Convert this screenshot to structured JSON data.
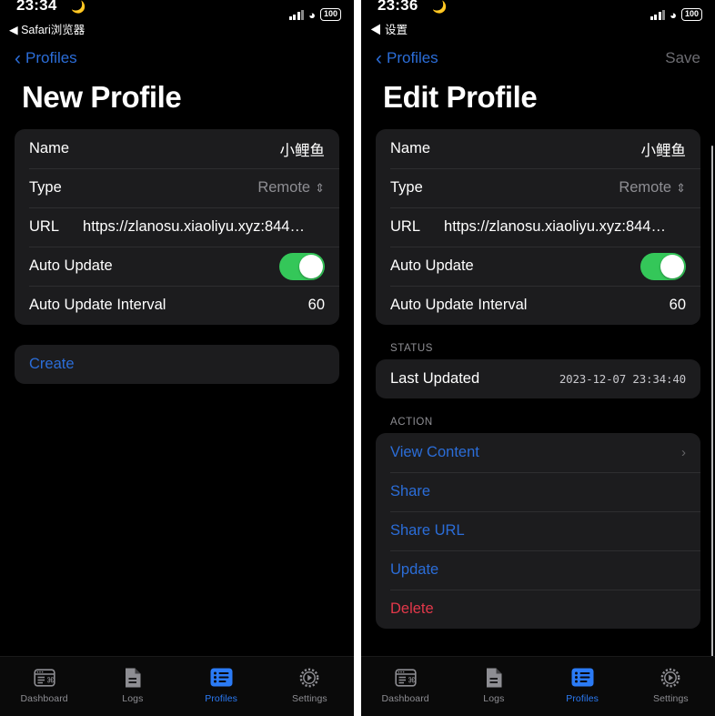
{
  "left": {
    "statusbar": {
      "time": "23:34",
      "moon_icon": "moon-icon",
      "back_app": "◀ Safari浏览器",
      "signal_icon": "cellular-bars-icon",
      "wifi_icon": "wifi-icon",
      "battery": "100"
    },
    "nav": {
      "back_label": "Profiles",
      "back_icon": "chevron-left-icon",
      "action_label": ""
    },
    "title": "New Profile",
    "form": {
      "rows": [
        {
          "label": "Name",
          "value": "小鲤鱼"
        },
        {
          "label": "Type",
          "value": "Remote",
          "chevron": "⌃⌄"
        },
        {
          "label": "URL",
          "value": "https://zlanosu.xiaoliyu.xyz:844…"
        },
        {
          "label": "Auto Update",
          "toggle": "on"
        },
        {
          "label": "Auto Update Interval",
          "value": "60"
        }
      ]
    },
    "create_button": "Create"
  },
  "right": {
    "statusbar": {
      "time": "23:36",
      "moon_icon": "moon-icon",
      "back_app": "◀ 设置",
      "signal_icon": "cellular-bars-icon",
      "wifi_icon": "wifi-icon",
      "battery": "100"
    },
    "nav": {
      "back_label": "Profiles",
      "back_icon": "chevron-left-icon",
      "action_label": "Save"
    },
    "title": "Edit Profile",
    "form": {
      "rows": [
        {
          "label": "Name",
          "value": "小鲤鱼"
        },
        {
          "label": "Type",
          "value": "Remote",
          "chevron": "⌃⌄"
        },
        {
          "label": "URL",
          "value": "https://zlanosu.xiaoliyu.xyz:844…"
        },
        {
          "label": "Auto Update",
          "toggle": "on"
        },
        {
          "label": "Auto Update Interval",
          "value": "60"
        }
      ]
    },
    "status_section": {
      "header": "STATUS",
      "label": "Last Updated",
      "value": "2023-12-07 23:34:40"
    },
    "action_section": {
      "header": "ACTION",
      "items": [
        {
          "label": "View Content",
          "chevron": "›",
          "style": "link"
        },
        {
          "label": "Share",
          "style": "link"
        },
        {
          "label": "Share URL",
          "style": "link"
        },
        {
          "label": "Update",
          "style": "link"
        },
        {
          "label": "Delete",
          "style": "danger"
        }
      ]
    }
  },
  "tabbar": {
    "tabs": [
      {
        "label": "Dashboard",
        "icon": "dashboard-window-icon",
        "active": false
      },
      {
        "label": "Logs",
        "icon": "document-icon",
        "active": false
      },
      {
        "label": "Profiles",
        "icon": "list-icon",
        "active": true
      },
      {
        "label": "Settings",
        "icon": "gear-icon",
        "active": false
      }
    ]
  },
  "colors": {
    "accent": "#2b7bf6",
    "link": "#2b6dd8",
    "danger": "#e2384a",
    "toggle_on": "#34c759",
    "group_bg": "#1c1c1e",
    "background": "#000000"
  }
}
